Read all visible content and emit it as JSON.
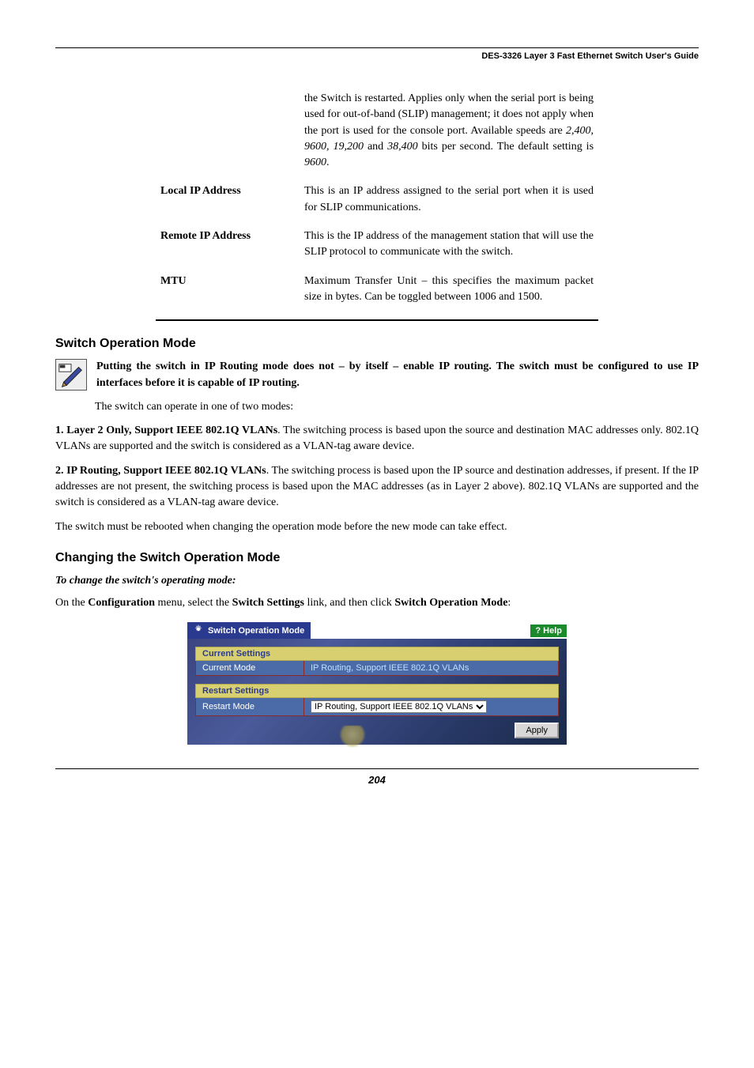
{
  "header": {
    "right": "DES-3326 Layer 3 Fast Ethernet Switch User's Guide"
  },
  "params": {
    "baud_prev_desc": "the Switch is restarted. Applies only when the serial port is being used for out-of-band (SLIP) management; it does not apply when the port is used for the console port. Available speeds are 2,400, 9600, 19,200 and 38,400 bits per second. The default setting is 9600.",
    "local_ip_label": "Local IP Address",
    "local_ip_desc": "This is an IP address assigned to the serial port when it is used for SLIP communications.",
    "remote_ip_label": "Remote IP Address",
    "remote_ip_desc": "This is the IP address of the management station that will use the SLIP protocol to communicate with the switch.",
    "mtu_label": "MTU",
    "mtu_desc": "Maximum Transfer Unit – this specifies the maximum packet size in bytes.  Can be toggled between 1006 and 1500."
  },
  "sections": {
    "switch_op_mode": "Switch Operation Mode",
    "changing_mode": "Changing the Switch Operation Mode",
    "to_change": "To change the switch's operating mode:"
  },
  "note": {
    "text": "Putting the switch in IP Routing mode does not – by itself – enable IP routing. The switch must be configured to use IP interfaces before it is capable of IP routing."
  },
  "body": {
    "operate_modes": "The switch can operate in one of two modes:",
    "item1_lead": "1. Layer 2 Only, Support IEEE 802.1Q VLANs",
    "item1_rest": ". The switching process is based upon the source and destination MAC addresses only. 802.1Q VLANs are supported and the switch is considered as a VLAN-tag aware device.",
    "item2_lead": "2. IP Routing, Support IEEE 802.1Q VLANs",
    "item2_rest": ". The switching process is based upon the IP source and destination addresses, if present.  If the IP addresses are not present, the switching process is based upon the MAC addresses (as in Layer 2 above). 802.1Q VLANs are supported and the switch is considered as a VLAN-tag aware device.",
    "reboot_note": "The switch must be rebooted when changing the operation mode before the new mode can take effect.",
    "config_menu_pre": "On the ",
    "config_menu_conf": "Configuration",
    "config_menu_mid1": " menu, select the ",
    "config_menu_ss": "Switch Settings",
    "config_menu_mid2": " link, and then click ",
    "config_menu_som": "Switch Operation Mode",
    "config_menu_end": ":"
  },
  "screenshot": {
    "title": "Switch Operation Mode",
    "help": "Help",
    "current_settings": "Current Settings",
    "current_mode": "Current Mode",
    "current_mode_value": "IP Routing, Support IEEE 802.1Q VLANs",
    "restart_settings": "Restart Settings",
    "restart_mode": "Restart Mode",
    "restart_mode_value": "IP Routing, Support IEEE 802.1Q VLANs",
    "apply": "Apply"
  },
  "footer": {
    "page": "204"
  }
}
